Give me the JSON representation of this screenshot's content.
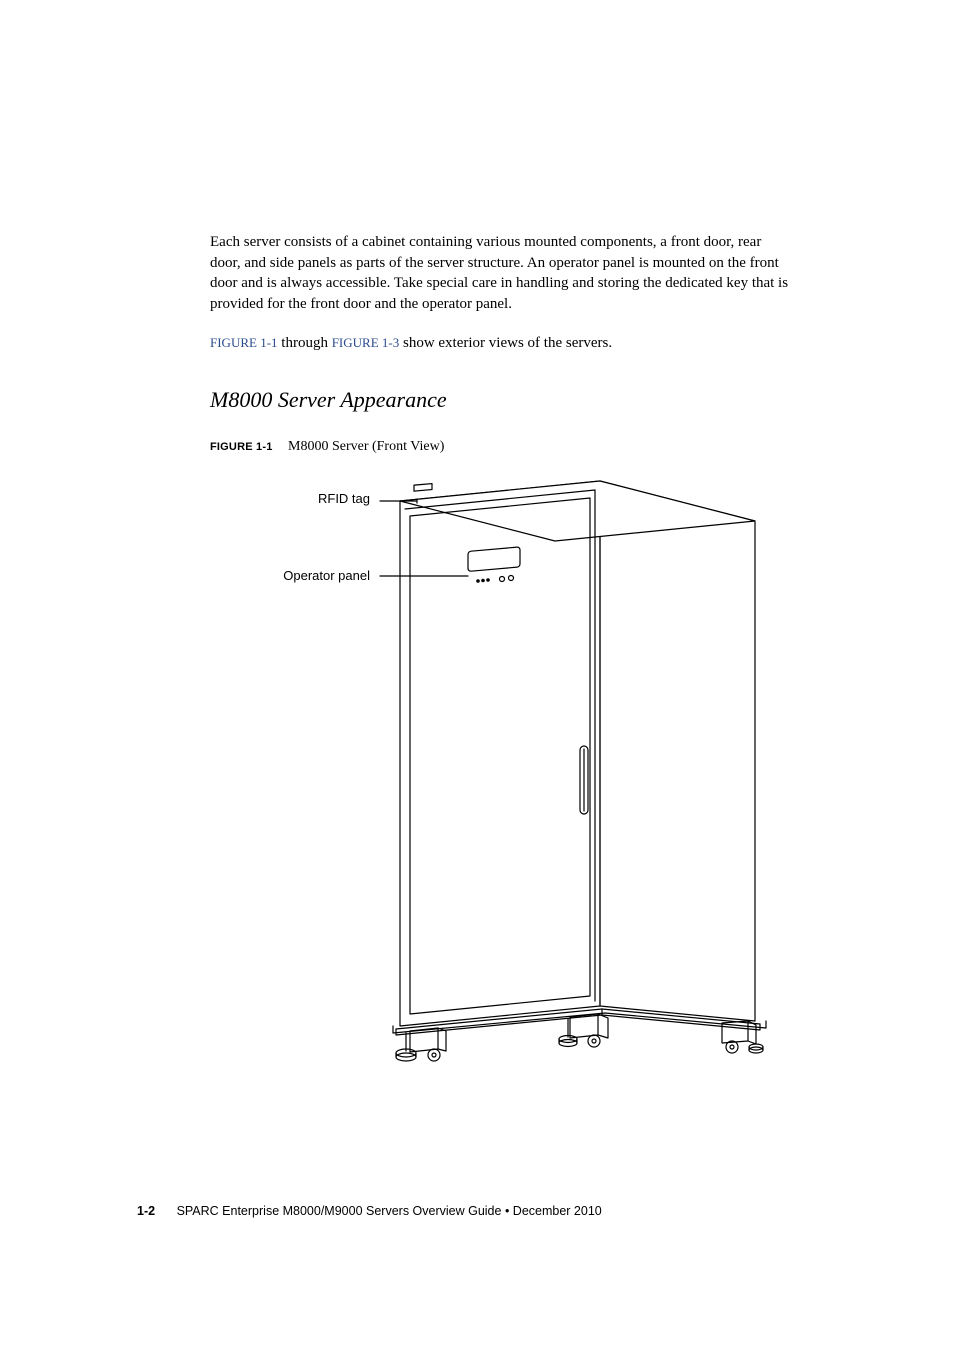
{
  "body": {
    "para1": "Each server consists of a cabinet containing various mounted components, a front door, rear door, and side panels as parts of the server structure. An operator panel is mounted on the front door and is always accessible. Take special care in handling and storing the dedicated key that is provided for the front door and the operator panel.",
    "link1": "FIGURE 1-1",
    "connector": " through ",
    "link2": "FIGURE 1-3",
    "after_links": " show exterior views of the servers."
  },
  "heading": "M8000 Server Appearance",
  "figure": {
    "label": "FIGURE 1-1",
    "caption": "M8000 Server (Front View)",
    "callouts": {
      "rfid": "RFID tag",
      "operator": "Operator panel"
    }
  },
  "footer": {
    "pageno": "1-2",
    "title": "SPARC Enterprise M8000/M9000 Servers Overview Guide  •  December 2010"
  }
}
